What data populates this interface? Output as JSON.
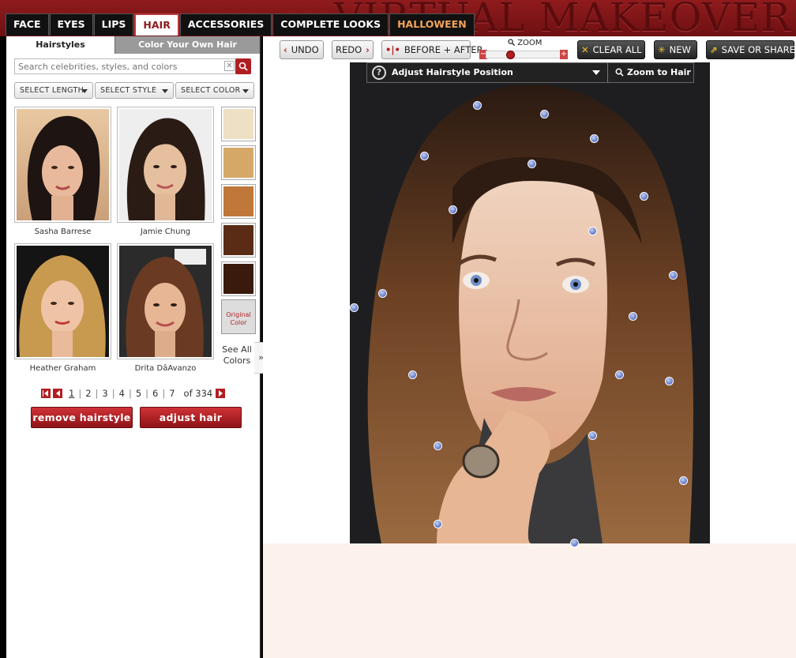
{
  "brand": "VIRTUAL MAKEOVER",
  "nav": [
    "FACE",
    "EYES",
    "LIPS",
    "HAIR",
    "ACCESSORIES",
    "COMPLETE LOOKS",
    "HALLOWEEN"
  ],
  "nav_active": "HAIR",
  "subtabs": {
    "hairstyles": "Hairstyles",
    "color": "Color Your Own Hair"
  },
  "search": {
    "placeholder": "Search celebrities, styles, and colors",
    "clear": "✕"
  },
  "filters": {
    "length": "SELECT LENGTH",
    "style": "SELECT STYLE",
    "color": "SELECT COLOR"
  },
  "thumbnails": [
    {
      "name": "Sasha Barrese"
    },
    {
      "name": "Jamie Chung"
    },
    {
      "name": "Heather Graham"
    },
    {
      "name": "Drita DâAvanzo"
    }
  ],
  "swatches": [
    "#ede0c4",
    "#d6a867",
    "#c0773a",
    "#5a2c16",
    "#3a1a0d"
  ],
  "original_color": "Original Color",
  "see_all_colors": "See All Colors",
  "collapse": "»",
  "pagination": {
    "pages": [
      "1",
      "2",
      "3",
      "4",
      "5",
      "6",
      "7"
    ],
    "current": "1",
    "of_text": "of 334"
  },
  "buttons": {
    "remove": "remove hairstyle",
    "adjust": "adjust hair"
  },
  "toolbar": {
    "undo": "UNDO",
    "redo": "REDO",
    "before_after": "BEFORE + AFTER",
    "zoom": "ZOOM",
    "zoom_minus": "−",
    "zoom_plus": "+",
    "clear_all": "CLEAR ALL",
    "new": "NEW",
    "save_share": "SAVE OR SHARE"
  },
  "hair_bar": {
    "help": "?",
    "position": "Adjust Hairstyle Position",
    "zoom_to_hair": "Zoom to Hair"
  },
  "colors": {
    "brand_red": "#8f1b1d",
    "accent_red": "#b01e22",
    "control_point": "#5a72c4"
  }
}
